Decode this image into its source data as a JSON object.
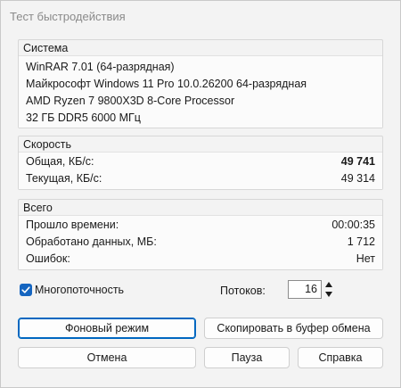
{
  "window": {
    "title": "Тест быстродействия"
  },
  "system": {
    "title": "Система",
    "lines": [
      "WinRAR 7.01 (64-разрядная)",
      "Майкрософт Windows 11 Pro 10.0.26200 64-разрядная",
      "AMD Ryzen 7 9800X3D 8-Core Processor",
      "32 ГБ DDR5 6000 МГц"
    ]
  },
  "speed": {
    "title": "Скорость",
    "rows": [
      {
        "label": "Общая, КБ/с:",
        "value": "49 741"
      },
      {
        "label": "Текущая, КБ/с:",
        "value": "49 314"
      }
    ]
  },
  "total": {
    "title": "Всего",
    "rows": [
      {
        "label": "Прошло времени:",
        "value": "00:00:35"
      },
      {
        "label": "Обработано данных, МБ:",
        "value": "1 712"
      },
      {
        "label": "Ошибок:",
        "value": "Нет"
      }
    ]
  },
  "options": {
    "multithreading_label": "Многопоточность",
    "multithreading_checked": true,
    "threads_label": "Потоков:",
    "threads_value": "16"
  },
  "buttons": {
    "background": "Фоновый режим",
    "copy": "Скопировать в буфер обмена",
    "cancel": "Отмена",
    "pause": "Пауза",
    "help": "Справка"
  },
  "colors": {
    "accent": "#0067c0",
    "checkbox": "#1565c0"
  }
}
